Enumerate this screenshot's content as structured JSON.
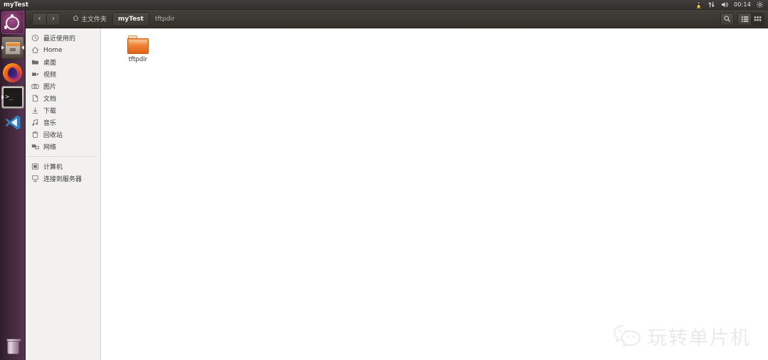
{
  "panel": {
    "title": "myTest",
    "tray": {
      "input_method_icon": "penguin-icon",
      "network_icon": "network-updown-icon",
      "volume_icon": "volume-icon",
      "clock": "00:14",
      "settings_icon": "gear-icon"
    }
  },
  "launcher": {
    "items": [
      {
        "name": "ubuntu-dash",
        "label": "Ubuntu Dash",
        "running": false,
        "focused": false
      },
      {
        "name": "files",
        "label": "Files",
        "running": true,
        "focused": true
      },
      {
        "name": "firefox",
        "label": "Firefox",
        "running": false,
        "focused": false
      },
      {
        "name": "terminal",
        "label": "Terminal",
        "running": true,
        "focused": false
      },
      {
        "name": "vscode",
        "label": "Visual Studio Code",
        "running": false,
        "focused": false
      }
    ],
    "trash_label": "Trash"
  },
  "toolbar": {
    "back_glyph": "‹",
    "forward_glyph": "›",
    "breadcrumbs": [
      {
        "label": "主文件夹",
        "icon": "home-icon",
        "active": false
      },
      {
        "label": "myTest",
        "icon": "",
        "active": true
      },
      {
        "label": "tftpdir",
        "icon": "",
        "active": false
      }
    ],
    "search_icon": "search-icon",
    "list_view_icon": "list-view-icon",
    "grid_view_icon": "grid-view-icon"
  },
  "sidebar": {
    "items": [
      {
        "label": "最近使用的",
        "icon": "clock-icon"
      },
      {
        "label": "Home",
        "icon": "home-icon"
      },
      {
        "label": "桌面",
        "icon": "folder-icon"
      },
      {
        "label": "视频",
        "icon": "video-icon"
      },
      {
        "label": "图片",
        "icon": "camera-icon"
      },
      {
        "label": "文档",
        "icon": "document-icon"
      },
      {
        "label": "下载",
        "icon": "download-icon"
      },
      {
        "label": "音乐",
        "icon": "music-icon"
      },
      {
        "label": "回收站",
        "icon": "trash-icon"
      },
      {
        "label": "网络",
        "icon": "network-icon"
      }
    ],
    "items_bottom": [
      {
        "label": "计算机",
        "icon": "computer-icon"
      },
      {
        "label": "连接到服务器",
        "icon": "server-connect-icon"
      }
    ]
  },
  "content": {
    "files": [
      {
        "name": "tftpdir",
        "type": "folder"
      }
    ]
  },
  "watermark": {
    "text": "玩转单片机",
    "icon": "wechat-icon"
  },
  "colors": {
    "panel_bg": "#373431",
    "launcher_bg": "#42283c",
    "toolbar_bg": "#3a3733",
    "sidebar_bg": "#f2f1f0",
    "content_bg": "#ffffff",
    "folder_orange": "#e8732a",
    "accent_text": "#f3f1ef"
  }
}
